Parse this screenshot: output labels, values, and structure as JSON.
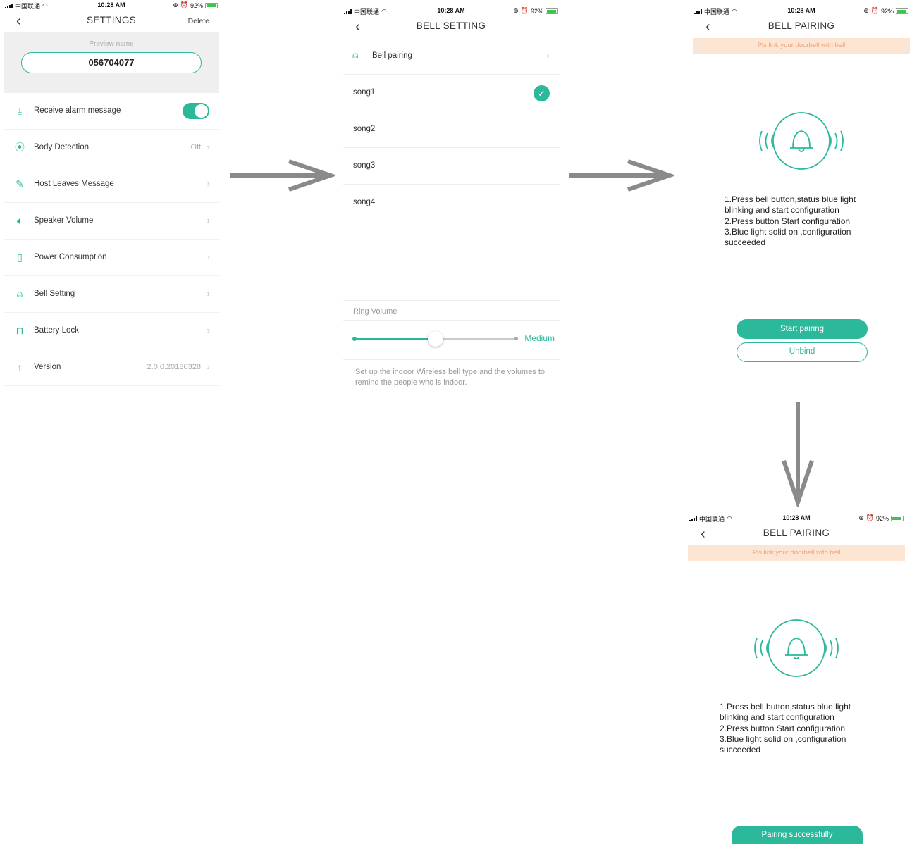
{
  "status_bar": {
    "carrier": "中国联通",
    "time": "10:28 AM",
    "battery": "92%"
  },
  "settings": {
    "title": "SETTINGS",
    "action": "Delete",
    "preview_label": "Preview name",
    "device_name": "056704077",
    "rows": [
      {
        "label": "Receive alarm message",
        "icon": "download-icon",
        "toggle": true
      },
      {
        "label": "Body Detection",
        "icon": "body-detect-icon",
        "value": "Off"
      },
      {
        "label": "Host Leaves Message",
        "icon": "edit-icon"
      },
      {
        "label": "Speaker Volume",
        "icon": "speaker-icon"
      },
      {
        "label": "Power Consumption",
        "icon": "battery-icon"
      },
      {
        "label": "Bell Setting",
        "icon": "bell-icon"
      },
      {
        "label": "Battery Lock",
        "icon": "lock-icon"
      },
      {
        "label": "Version",
        "icon": "upload-icon",
        "value": "2.0.0.20180328"
      }
    ]
  },
  "bell_setting": {
    "title": "BELL SETTING",
    "pairing_label": "Bell pairing",
    "songs": [
      "song1",
      "song2",
      "song3",
      "song4"
    ],
    "selected_song": "song1",
    "ring_volume_label": "Ring Volume",
    "ring_volume_value": "Medium",
    "ring_volume_level": 0.5,
    "description": "Set up the indoor Wireless bell type and the volumes to remind the people who is indoor."
  },
  "bell_pairing": {
    "title": "BELL PAIRING",
    "banner": "Pls link your doorbell with bell",
    "instructions": [
      "1.Press bell button,status blue light",
      "blinking and start configuration",
      "2.Press button Start configuration",
      "3.Blue light solid on ,configuration",
      "succeeded"
    ],
    "start_button": "Start pairing",
    "unbind_button": "Unbind",
    "success_button": "Pairing successfully"
  },
  "colors": {
    "accent": "#2bb89b",
    "banner_bg": "#fde5d3",
    "banner_text": "#e8a77e",
    "arrow": "#8a8a8a"
  }
}
